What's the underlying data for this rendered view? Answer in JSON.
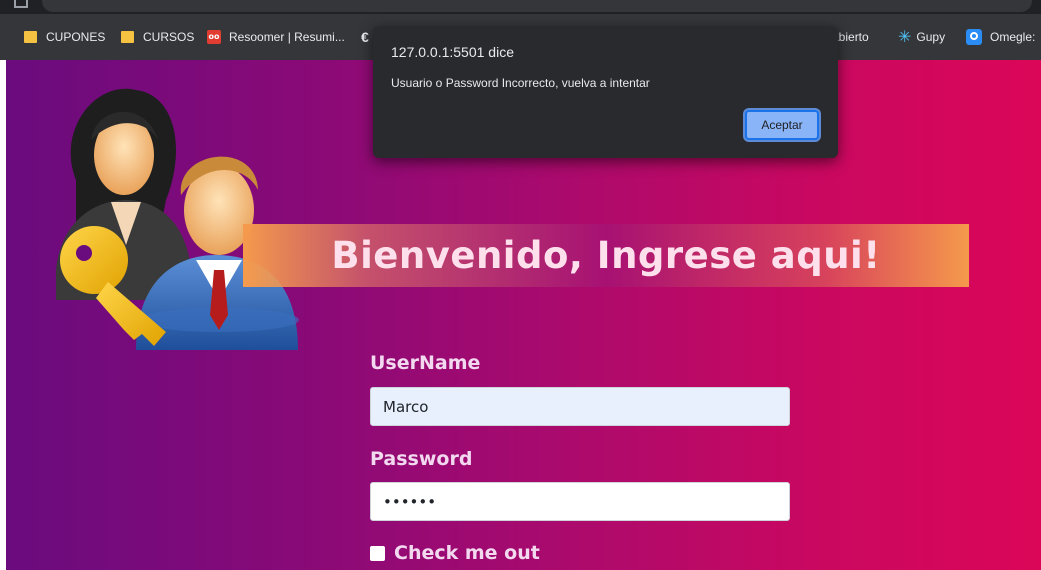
{
  "bookmarks": [
    {
      "label": "CUPONES",
      "icon": "folder-icon"
    },
    {
      "label": "CURSOS",
      "icon": "folder-icon"
    },
    {
      "label": "Resoomer | Resumi...",
      "icon": "resoomer-icon"
    },
    {
      "label": "",
      "icon": "euro-icon"
    },
    {
      "label": "abierto",
      "icon": ""
    },
    {
      "label": "Gupy",
      "icon": "gupy-icon"
    },
    {
      "label": "Omegle:",
      "icon": "omegle-icon"
    }
  ],
  "page": {
    "banner_title": "Bienvenido, Ingrese aqui!",
    "username_label": "UserName",
    "username_value": "Marco",
    "password_label": "Password",
    "password_value": "••••••",
    "check_label": "Check me out"
  },
  "alert": {
    "title": "127.0.0.1:5501 dice",
    "message": "Usuario o Password Incorrecto, vuelva a intentar",
    "ok_label": "Aceptar"
  },
  "colors": {
    "gradient_start": "#6a0b7e",
    "gradient_end": "#db0658",
    "banner_accent": "#f59a4c",
    "dialog_bg": "#292a2d",
    "dialog_button": "#8ab4f8"
  }
}
